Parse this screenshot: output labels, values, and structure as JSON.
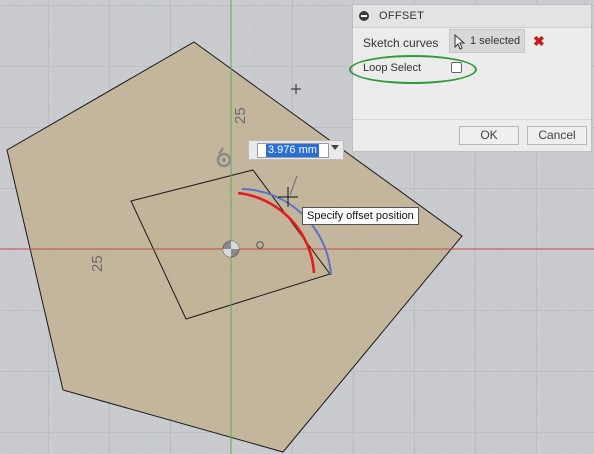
{
  "viewport": {
    "background": "#c9cbce",
    "grid_color": "#b7b9bc",
    "sketch_fill": "#c2b193",
    "x_axis_color": "#c24a4a",
    "y_axis_color": "#56b156",
    "dimensions": {
      "top": "25",
      "left": "25"
    },
    "offset_input": {
      "value": "3.976 mm"
    },
    "tooltip": "Specify offset position",
    "icons": [
      "compass-icon",
      "origin-icon",
      "crosshair-cursor-icon",
      "plus-cursor-icon"
    ]
  },
  "dialog": {
    "title": "OFFSET",
    "sketch_curves_label": "Sketch curves",
    "selection_label": "1 selected",
    "loop_select_label": "Loop Select",
    "loop_select_checked": false,
    "ok_label": "OK",
    "cancel_label": "Cancel",
    "highlight_color": "#2e9b3c",
    "clear_color": "#c41a1a"
  }
}
